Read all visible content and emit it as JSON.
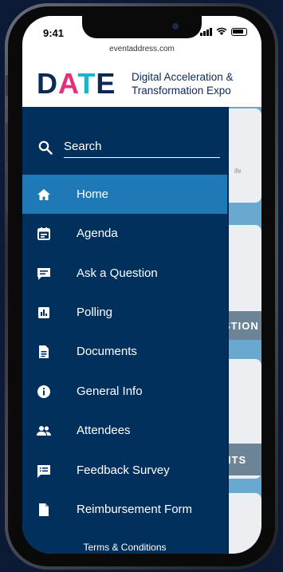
{
  "status_bar": {
    "time": "9:41",
    "url": "eventaddress.com"
  },
  "logo": {
    "d": "D",
    "a": "A",
    "t": "T",
    "e": "E"
  },
  "header": {
    "subtitle_line1": "Digital Acceleration &",
    "subtitle_line2": "Transformation Expo"
  },
  "search": {
    "placeholder": "Search"
  },
  "menu": {
    "items": [
      {
        "label": "Home",
        "icon": "home-icon",
        "active": true
      },
      {
        "label": "Agenda",
        "icon": "calendar-icon"
      },
      {
        "label": "Ask a Question",
        "icon": "chat-icon"
      },
      {
        "label": "Polling",
        "icon": "poll-chart-icon"
      },
      {
        "label": "Documents",
        "icon": "document-icon"
      },
      {
        "label": "General Info",
        "icon": "info-icon"
      },
      {
        "label": "Attendees",
        "icon": "people-icon"
      },
      {
        "label": "Feedback Survey",
        "icon": "feedback-icon"
      },
      {
        "label": "Reimbursement Form",
        "icon": "form-file-icon"
      }
    ]
  },
  "footer": {
    "terms": "Terms & Conditions"
  },
  "background": {
    "band1": "STION",
    "band2": "ITS",
    "card_text": "ife"
  },
  "colors": {
    "drawer": "#02305c",
    "active": "#1f79b6",
    "page_bg": "#6aa9cf"
  }
}
